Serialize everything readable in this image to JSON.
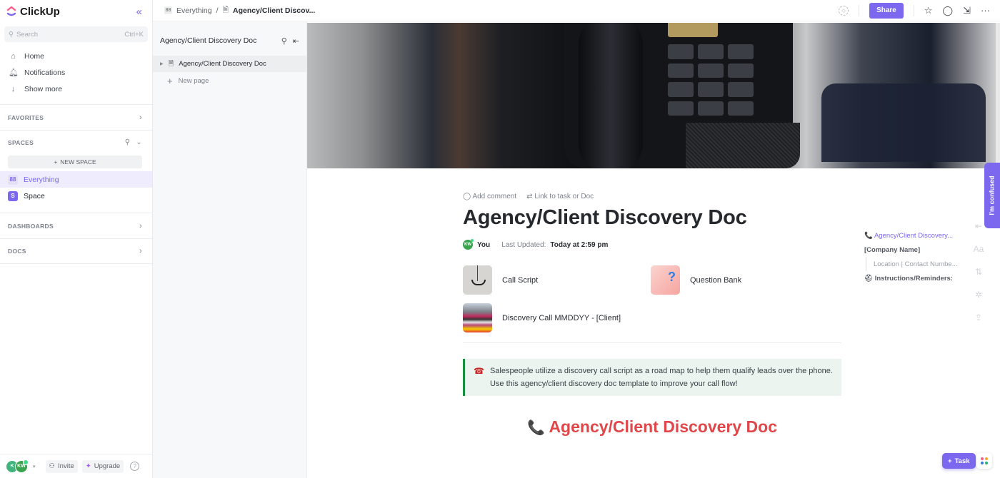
{
  "app": {
    "name": "ClickUp"
  },
  "sidebar": {
    "search": {
      "placeholder": "Search",
      "shortcut": "Ctrl+K"
    },
    "nav": [
      {
        "label": "Home",
        "icon": "home-icon"
      },
      {
        "label": "Notifications",
        "icon": "bell-icon"
      },
      {
        "label": "Show more",
        "icon": "arrow-down-icon"
      }
    ],
    "favorites_label": "FAVORITES",
    "spaces_label": "SPACES",
    "new_space_label": "NEW SPACE",
    "spaces": [
      {
        "label": "Everything",
        "badge": "88",
        "active": true
      },
      {
        "label": "Space",
        "badge": "S",
        "active": false
      }
    ],
    "dashboards_label": "DASHBOARDS",
    "docs_label": "DOCS",
    "footer": {
      "avatar1": "K",
      "avatar2": "KW",
      "invite_label": "Invite",
      "upgrade_label": "Upgrade",
      "help": "?"
    }
  },
  "topbar": {
    "breadcrumb": [
      {
        "label": "Everything"
      },
      {
        "label": "Agency/Client Discov..."
      }
    ],
    "separator": "/",
    "share_label": "Share"
  },
  "tree": {
    "title": "Agency/Client Discovery Doc",
    "items": [
      {
        "label": "Agency/Client Discovery Doc"
      }
    ],
    "new_page_label": "New page"
  },
  "doc": {
    "add_comment_label": "Add comment",
    "link_label": "Link to task or Doc",
    "title": "Agency/Client Discovery Doc",
    "author_initials": "KW",
    "author": "You",
    "last_updated_label": "Last Updated:",
    "last_updated_value": "Today at 2:59 pm",
    "subpages": [
      {
        "label": "Call Script",
        "thumb": "call"
      },
      {
        "label": "Question Bank",
        "thumb": "qbank"
      },
      {
        "label": "Discovery Call MMDDYY - [Client]",
        "thumb": "disc"
      }
    ],
    "callout": {
      "emoji": "☎",
      "text": "Salespeople utilize a discovery call script as a road map to help them qualify leads over the phone. Use this agency/client discovery doc template to improve your call flow!",
      "border_color": "#16913e"
    },
    "heading": {
      "emoji": "📞",
      "text": "Agency/Client Discovery Doc",
      "color": "#e0474a"
    }
  },
  "outline": [
    {
      "label": "📞 Agency/Client Discovery..."
    },
    {
      "label": "[Company Name]"
    },
    {
      "label": "Location | Contact Numbe..."
    },
    {
      "label": "⛑ Instructions/Reminders:"
    }
  ],
  "feedback_tab": "I'm confused",
  "task_button_label": "Task",
  "colors": {
    "accent": "#7b68ee",
    "callout_bg": "#ebf4ef",
    "heading_red": "#e0474a"
  }
}
